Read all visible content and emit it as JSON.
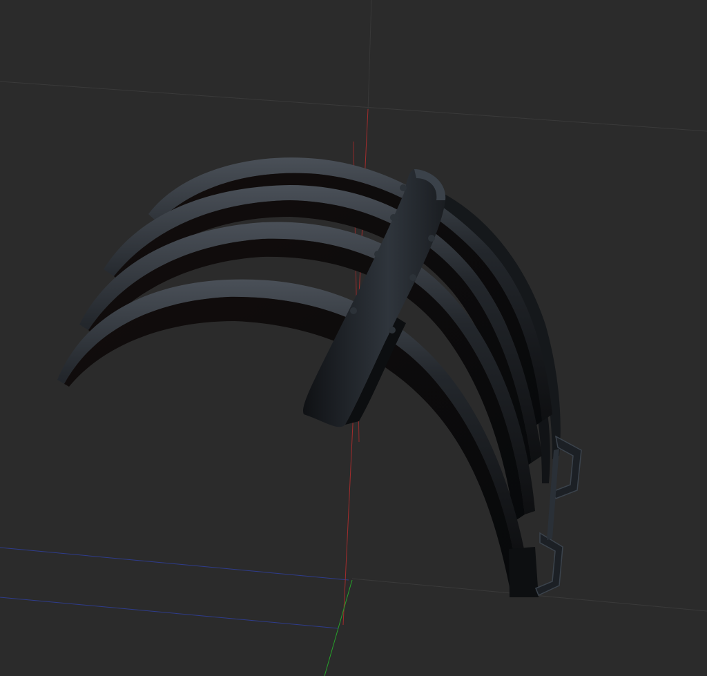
{
  "viewport": {
    "background": "#2b2b2b",
    "grid_color": "#3a3a3a",
    "axis_x_color": "#b03030",
    "axis_y_color": "#2aa02a",
    "axis_z_color": "#3040a8",
    "model_color": "#1a1d21",
    "model_highlight": "#3a4048"
  },
  "scene": {
    "object": "claw-bracket-model"
  }
}
